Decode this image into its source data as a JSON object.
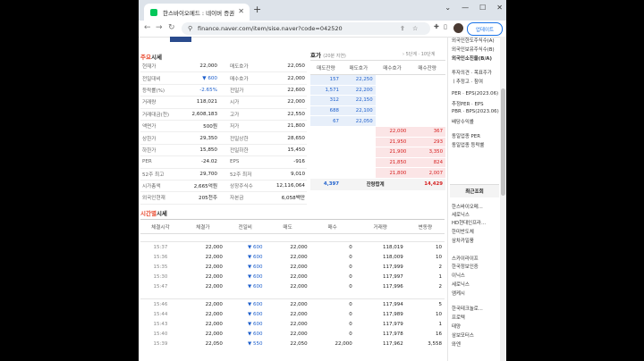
{
  "browser": {
    "tab_title": "한스바이오메드 : 네이버 증권",
    "url": "finance.naver.com/item/sise.naver?code=042520",
    "update_label": "업데이트"
  },
  "summary": {
    "title_prefix": "주요",
    "title_suffix": "시세",
    "rows": [
      [
        "현재가",
        "22,000",
        "매도호가",
        "22,050"
      ],
      [
        "전일대비",
        "▼ 600",
        "매수호가",
        "22,000"
      ],
      [
        "등락률(%)",
        "-2.65%",
        "전일가",
        "22,600"
      ],
      [
        "거래량",
        "118,021",
        "시가",
        "22,000"
      ],
      [
        "거래대금(천)",
        "2,608,183",
        "고가",
        "22,550"
      ],
      [
        "액면가",
        "500원",
        "저가",
        "21,800"
      ],
      [
        "상한가",
        "29,350",
        "전일상한",
        "28,650"
      ],
      [
        "하한가",
        "15,850",
        "전일하한",
        "15,450"
      ],
      [
        "PER",
        "-24.02",
        "EPS",
        "-916"
      ],
      [
        "52주 최고",
        "29,700",
        "52주 최저",
        "9,010"
      ],
      [
        "시가총액",
        "2,665억원",
        "상장주식수",
        "12,116,064"
      ],
      [
        "외국인현재",
        "205천주",
        "자본금",
        "6,058백만"
      ]
    ]
  },
  "hoga": {
    "title": "호가",
    "subtitle": "(20분 지연)",
    "link": "› 5단계 · 10단계",
    "headers": [
      "매도잔량",
      "매도호가",
      "매수호가",
      "매수잔량"
    ],
    "asks": [
      [
        "157",
        "22,250"
      ],
      [
        "1,571",
        "22,200"
      ],
      [
        "312",
        "22,150"
      ],
      [
        "688",
        "22,100"
      ],
      [
        "67",
        "22,050"
      ]
    ],
    "bids": [
      [
        "22,000",
        "367"
      ],
      [
        "21,950",
        "293"
      ],
      [
        "21,900",
        "3,350"
      ],
      [
        "21,850",
        "824"
      ],
      [
        "21,800",
        "2,007"
      ]
    ],
    "total_ask": "4,397",
    "total_label": "잔량합계",
    "total_bid": "14,429"
  },
  "timeline": {
    "title_prefix": "시간별",
    "title_suffix": "시세",
    "headers": [
      "체결시각",
      "체결가",
      "전일비",
      "매도",
      "매수",
      "거래량",
      "변동량"
    ],
    "group1": [
      [
        "15:37",
        "22,000",
        "▼ 600",
        "22,000",
        "0",
        "118,019",
        "10"
      ],
      [
        "15:36",
        "22,000",
        "▼ 600",
        "22,000",
        "0",
        "118,009",
        "10"
      ],
      [
        "15:35",
        "22,000",
        "▼ 600",
        "22,000",
        "0",
        "117,999",
        "2"
      ],
      [
        "15:30",
        "22,000",
        "▼ 600",
        "22,000",
        "0",
        "117,997",
        "1"
      ],
      [
        "15:47",
        "22,000",
        "▼ 600",
        "22,000",
        "0",
        "117,996",
        "2"
      ]
    ],
    "group2": [
      [
        "15:46",
        "22,000",
        "▼ 600",
        "22,000",
        "0",
        "117,994",
        "5"
      ],
      [
        "15:44",
        "22,000",
        "▼ 600",
        "22,000",
        "0",
        "117,989",
        "10"
      ],
      [
        "15:43",
        "22,000",
        "▼ 600",
        "22,000",
        "0",
        "117,979",
        "1"
      ],
      [
        "15:40",
        "22,000",
        "▼ 600",
        "22,000",
        "0",
        "117,978",
        "16"
      ],
      [
        "15:39",
        "22,050",
        "▼ 550",
        "22,050",
        "22,000",
        "117,962",
        "3,558"
      ]
    ]
  },
  "rightcol": {
    "top_items": [
      "외국인한도주식수(A)",
      "외국인보유주식수(B)",
      "외국인소진율(B/A)"
    ],
    "invest_items": [
      "투자의견 · 목표주가",
      "PER · EPS(2023.06)",
      "추정PER · EPS",
      "PBR · BPS(2023.06)",
      "배당수익률"
    ],
    "invest_head": "투자의견 · 목표주가",
    "invest_sub": "ㅣ추정고 · 참여",
    "per_items": [
      "PER · EPS(2023.06)",
      "추정PER · EPS",
      "PBR · BPS(2023.06)",
      "배당수익률"
    ],
    "sector_items": [
      "동일업종 PER",
      "동일업종 등락률"
    ],
    "recent_title": "최근조회",
    "recent_items": [
      "한스바이오메...",
      "세로닉스",
      "HD현대인프라...",
      "한미반도체",
      "삼차카일풍",
      "스카이라이프",
      "한국정보인증",
      "이닉스",
      "세로닉스",
      "엠케시",
      "한국테크놀로...",
      "프로텍",
      "태양",
      "삼보모터스",
      "와엔"
    ]
  }
}
